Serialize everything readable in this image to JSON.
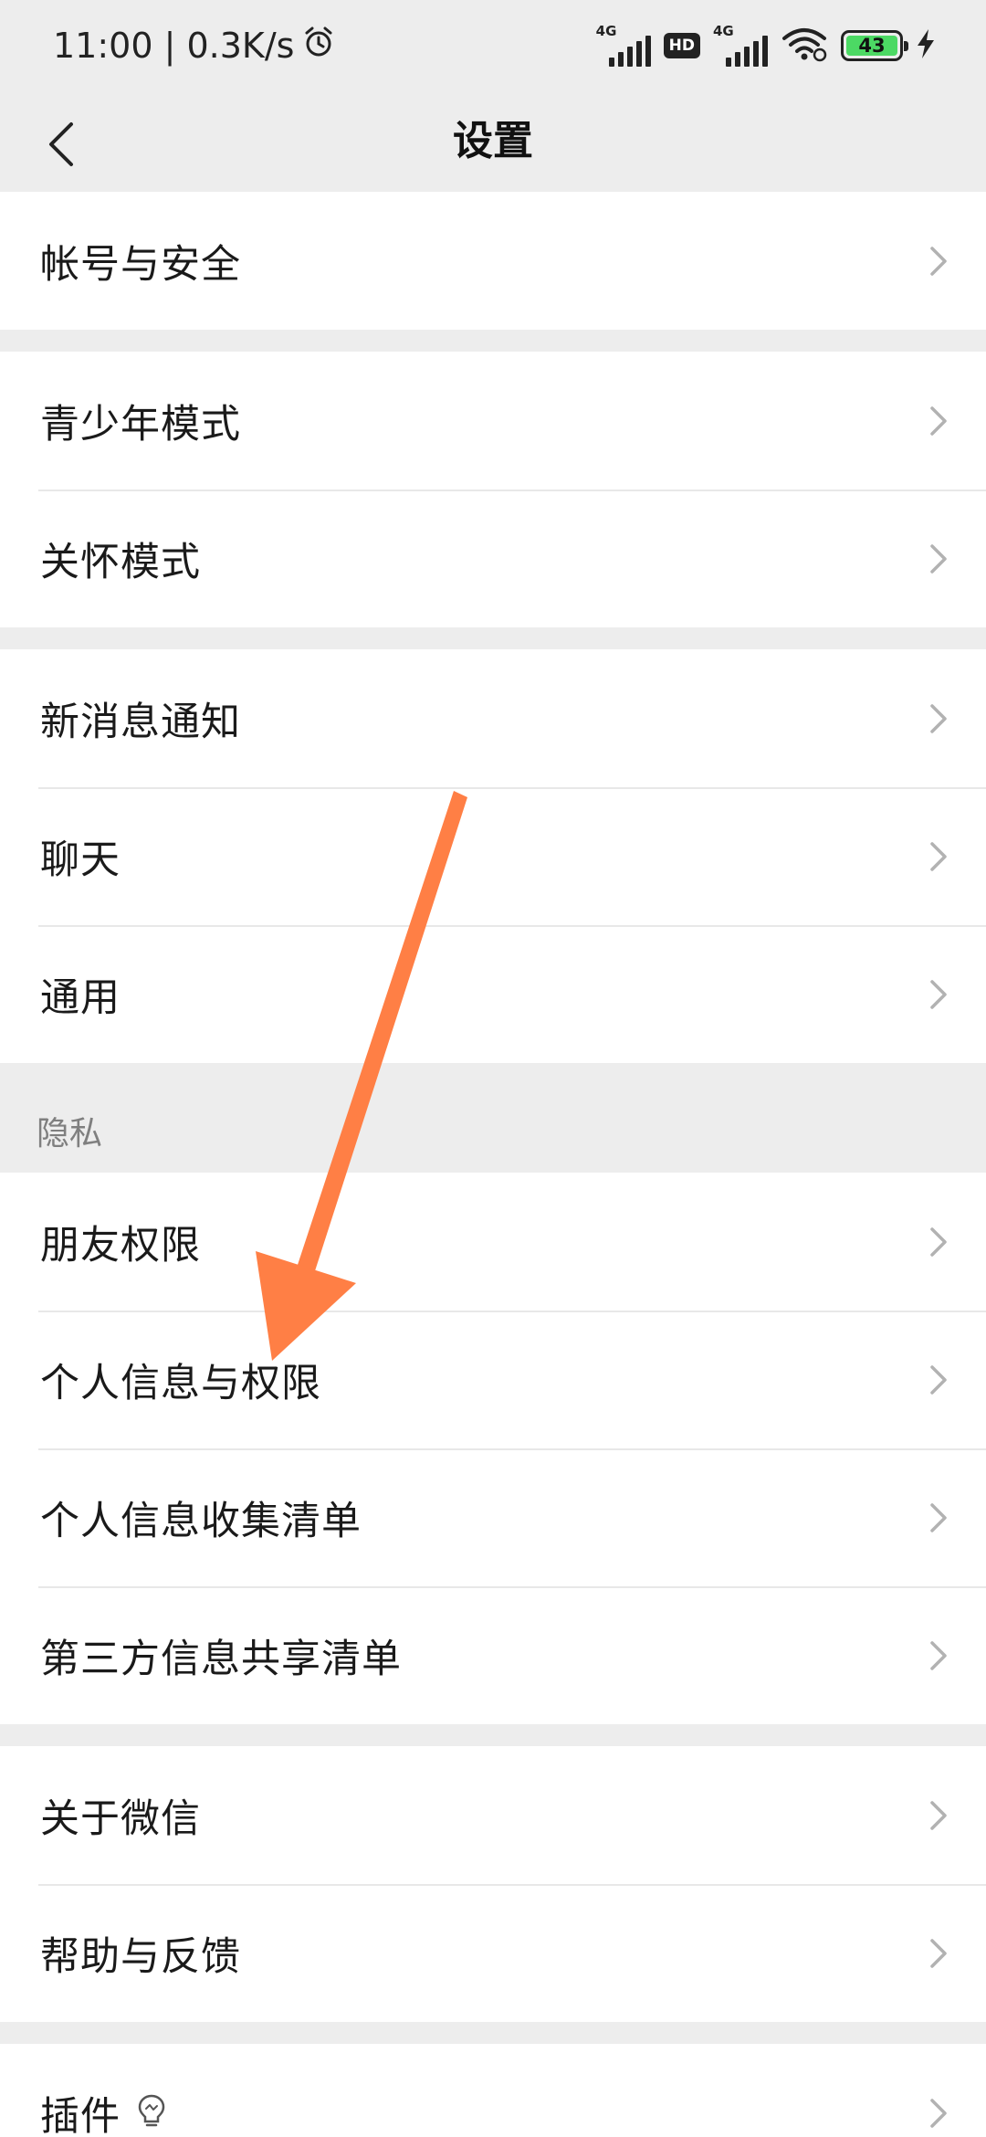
{
  "status_bar": {
    "time_speed": "11:00 | 0.3K/s",
    "network_1": "4G",
    "hd_badge": "HD",
    "network_2": "4G",
    "battery_level": "43",
    "icons": [
      "alarm-icon",
      "signal-icon",
      "wifi-icon",
      "battery-icon",
      "charging-icon"
    ]
  },
  "nav": {
    "title": "设置",
    "back_icon": "back-chevron-icon"
  },
  "groups": {
    "account": {
      "items": [
        {
          "label": "帐号与安全"
        }
      ]
    },
    "modes": {
      "items": [
        {
          "label": "青少年模式"
        },
        {
          "label": "关怀模式"
        }
      ]
    },
    "general": {
      "items": [
        {
          "label": "新消息通知"
        },
        {
          "label": "聊天"
        },
        {
          "label": "通用"
        }
      ]
    },
    "privacy": {
      "header": "隐私",
      "items": [
        {
          "label": "朋友权限"
        },
        {
          "label": "个人信息与权限"
        },
        {
          "label": "个人信息收集清单"
        },
        {
          "label": "第三方信息共享清单"
        }
      ]
    },
    "about": {
      "items": [
        {
          "label": "关于微信"
        },
        {
          "label": "帮助与反馈"
        }
      ]
    },
    "plugins": {
      "items": [
        {
          "label": "插件"
        }
      ]
    }
  },
  "colors": {
    "background": "#ededed",
    "row_background": "#ffffff",
    "annotation_arrow": "#ff7f45",
    "battery_fill": "#4cd964"
  }
}
